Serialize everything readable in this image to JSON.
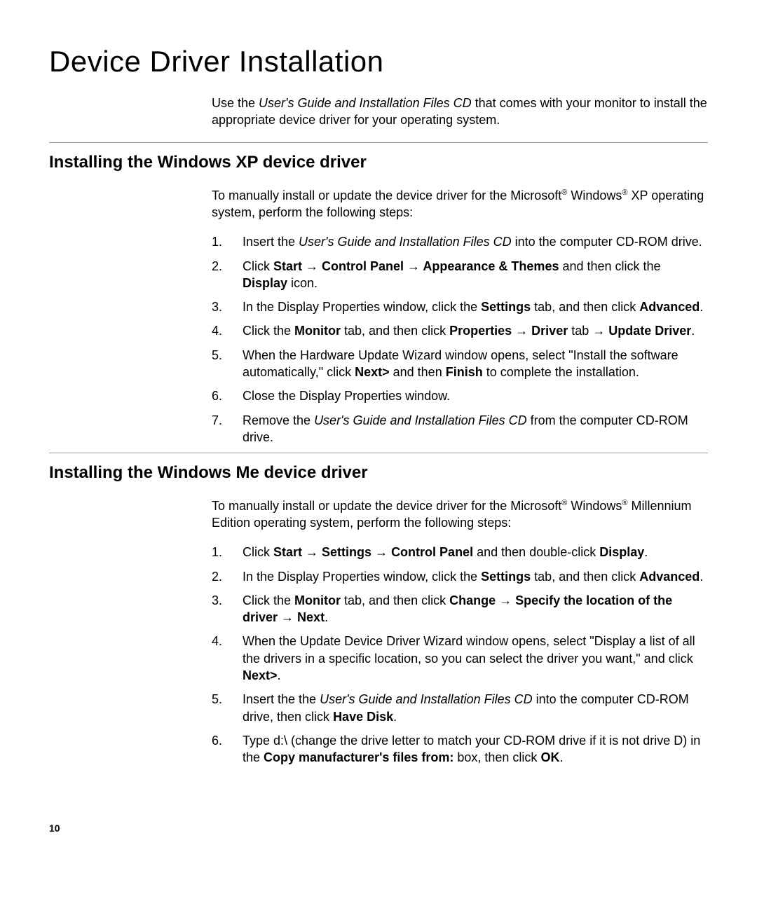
{
  "title": "Device Driver Installation",
  "intro_pre": "Use the ",
  "intro_cd": "User's Guide and Installation Files CD",
  "intro_post": " that comes with your monitor to install the appropriate device driver for your operating system.",
  "xp": {
    "heading": "Installing the Windows XP device driver",
    "intro_a": "To manually install or update the device driver for the Microsoft",
    "intro_b": " Windows",
    "intro_c": " XP operating system, perform the following steps:",
    "reg": "®",
    "steps": [
      {
        "num": "1.",
        "a": "Insert the ",
        "cd": "User's Guide and Installation Files CD",
        "b": " into the computer CD-ROM drive."
      },
      {
        "num": "2.",
        "a": "Click ",
        "b1": "Start",
        "ar": " → ",
        "b2": "Control Panel",
        "b3": "Appearance & Themes",
        "c": " and then click the ",
        "b4": "Display",
        "d": " icon."
      },
      {
        "num": "3.",
        "a": "In the Display Properties window, click the ",
        "b1": "Settings",
        "b": " tab, and then click ",
        "b2": "Advanced",
        "c": "."
      },
      {
        "num": "4.",
        "a": "Click the ",
        "b1": "Monitor",
        "b": " tab, and then click ",
        "b2": "Properties",
        "ar": " → ",
        "b3": "Driver",
        "c": " tab ",
        "b4": "Update Driver",
        "d": "."
      },
      {
        "num": "5.",
        "a": "When the Hardware Update Wizard window opens, select \"Install the software automatically,\" click ",
        "b1": "Next>",
        "b": " and then ",
        "b2": "Finish",
        "c": " to complete the installation."
      },
      {
        "num": "6.",
        "a": "Close the Display Properties window."
      },
      {
        "num": "7.",
        "a": "Remove the ",
        "cd": "User's Guide and Installation Files CD",
        "b": " from the computer CD-ROM drive."
      }
    ]
  },
  "me": {
    "heading": "Installing the Windows Me device driver",
    "intro_a": "To manually install or update the device driver for the Microsoft",
    "intro_b": " Windows",
    "intro_c": " Millennium Edition operating system, perform the following steps:",
    "reg": "®",
    "steps": [
      {
        "num": "1.",
        "a": "Click ",
        "b1": "Start",
        "ar": " → ",
        "b2": "Settings",
        "b3": "Control Panel",
        "c": " and then double-click ",
        "b4": "Display",
        "d": "."
      },
      {
        "num": "2.",
        "a": "In the Display Properties window, click the ",
        "b1": "Settings",
        "b": " tab, and then click ",
        "b2": "Advanced",
        "c": "."
      },
      {
        "num": "3.",
        "a": "Click the ",
        "b1": "Monitor",
        "b": " tab, and then click ",
        "b2": "Change",
        "ar": " → ",
        "b3": "Specify the location of the driver",
        "b4": "Next",
        "d": "."
      },
      {
        "num": "4.",
        "a": "When the Update Device Driver Wizard window opens, select   \"Display a list of all the drivers in a specific location, so you can select the driver you want,\" and click ",
        "b1": "Next>",
        "b": "."
      },
      {
        "num": "5.",
        "a": "Insert the the ",
        "cd": "User's Guide and Installation Files CD",
        "b": " into the computer CD-ROM drive, then click ",
        "b1": "Have Disk",
        "c": "."
      },
      {
        "num": "6.",
        "a": "Type d:\\ (change the drive letter to match your CD-ROM drive if it is not drive D) in the ",
        "b1": "Copy manufacturer's files from:",
        "b": " box, then click ",
        "b2": "OK",
        "c": "."
      }
    ]
  },
  "page_number": "10"
}
